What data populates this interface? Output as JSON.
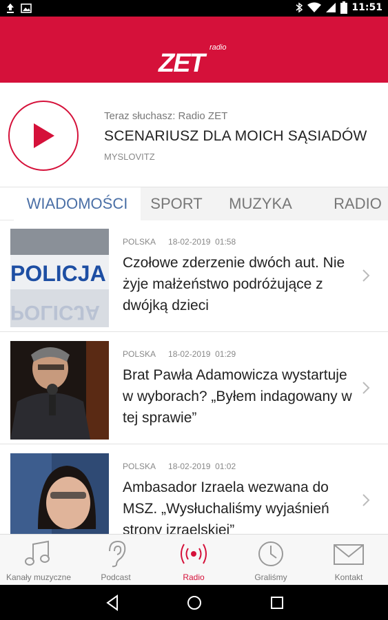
{
  "status_bar": {
    "time": "11:51"
  },
  "header": {
    "brand_small": "radio",
    "brand_main": "ZET",
    "accent_color": "#d5113a"
  },
  "player": {
    "now_listening": "Teraz słuchasz: Radio ZET",
    "song_title": "SCENARIUSZ DLA MOICH SĄSIADÓW",
    "artist": "MYSLOVITZ"
  },
  "tabs": [
    {
      "label": "WIADOMOŚCI",
      "active": true
    },
    {
      "label": "SPORT"
    },
    {
      "label": "MUZYKA"
    },
    {
      "label": "RADIO"
    }
  ],
  "news": [
    {
      "category": "POLSKA",
      "date": "18-02-2019",
      "time": "01:58",
      "title": "Czołowe zderzenie dwóch aut. Nie żyje małżeństwo podróżujące z dwójką dzieci",
      "image_text": "POLICJA"
    },
    {
      "category": "POLSKA",
      "date": "18-02-2019",
      "time": "01:29",
      "title": "Brat Pawła Adamowicza wystartuje w wyborach? „Byłem indagowany w tej sprawie”"
    },
    {
      "category": "POLSKA",
      "date": "18-02-2019",
      "time": "01:02",
      "title": "Ambasador Izraela wezwana do MSZ. „Wysłuchaliśmy wyjaśnień strony izraelskiej”"
    }
  ],
  "bottom_nav": [
    {
      "label": "Kanały muzyczne",
      "icon": "music-note-icon"
    },
    {
      "label": "Podcast",
      "icon": "ear-icon"
    },
    {
      "label": "Radio",
      "icon": "radio-waves-icon",
      "active": true
    },
    {
      "label": "Graliśmy",
      "icon": "clock-icon"
    },
    {
      "label": "Kontakt",
      "icon": "envelope-icon"
    }
  ]
}
